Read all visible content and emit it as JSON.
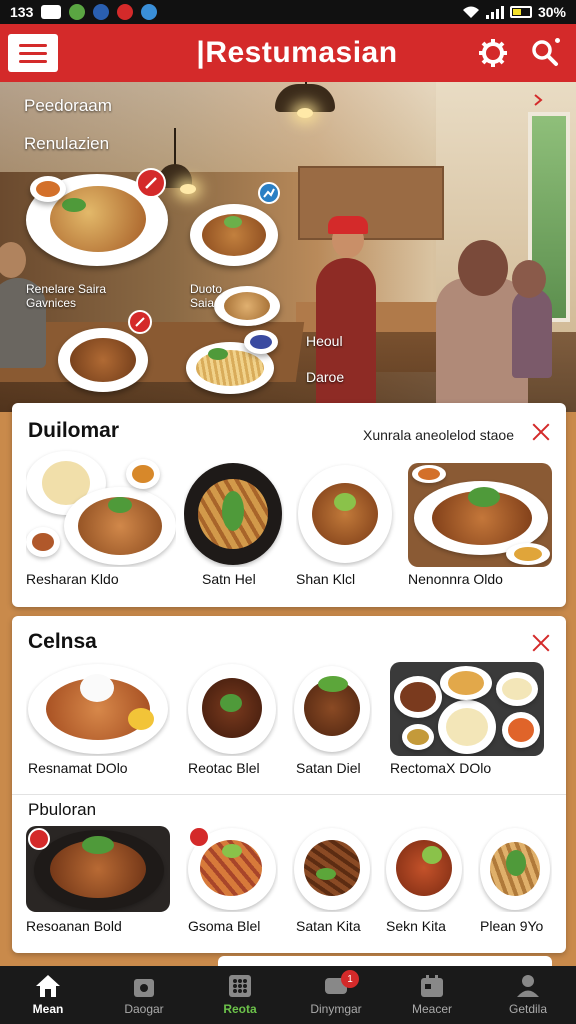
{
  "status_bar": {
    "time": "133",
    "battery": "30%"
  },
  "app_bar": {
    "title": "|Restumasian"
  },
  "hero": {
    "line1": "Peedoraam",
    "line2": "Renulazien",
    "label_left": "Renelare Saira\nGavnices",
    "label_mid": "Duoto\nSaia",
    "label_right1": "Heoul",
    "label_right2": "Daroe"
  },
  "card1": {
    "title": "Duilomar",
    "subtitle": "Xunrala aneolelod staoe",
    "items": [
      {
        "label": "Resharan Kldo"
      },
      {
        "label": "Satn Hel"
      },
      {
        "label": "Shan Klcl"
      },
      {
        "label": "Nenonnra Oldo"
      }
    ]
  },
  "card2": {
    "title": "Celnsa",
    "items": [
      {
        "label": "Resnamat DOlo"
      },
      {
        "label": "Reotac Blel"
      },
      {
        "label": "Satan Diel"
      },
      {
        "label": "RectomaX DOlo"
      }
    ],
    "section2_title": "Pbuloran",
    "items2": [
      {
        "label": "Resoanan Bold"
      },
      {
        "label": "Gsoma Blel"
      },
      {
        "label": "Satan Kita"
      },
      {
        "label": "Sekn Kita"
      },
      {
        "label": "Plean 9Yo"
      }
    ]
  },
  "bottom_nav": [
    {
      "label": "Mean",
      "icon": "home-icon"
    },
    {
      "label": "Daogar",
      "icon": "bag-icon"
    },
    {
      "label": "Reota",
      "icon": "grid-icon"
    },
    {
      "label": "Dinymgar",
      "icon": "chat-icon",
      "badge": "1"
    },
    {
      "label": "Meacer",
      "icon": "calendar-icon"
    },
    {
      "label": "Getdila",
      "icon": "profile-icon"
    }
  ],
  "colors": {
    "brand_red": "#d42a2a",
    "nav_bg": "#1a1a1a",
    "active_green": "#6cc24a"
  }
}
